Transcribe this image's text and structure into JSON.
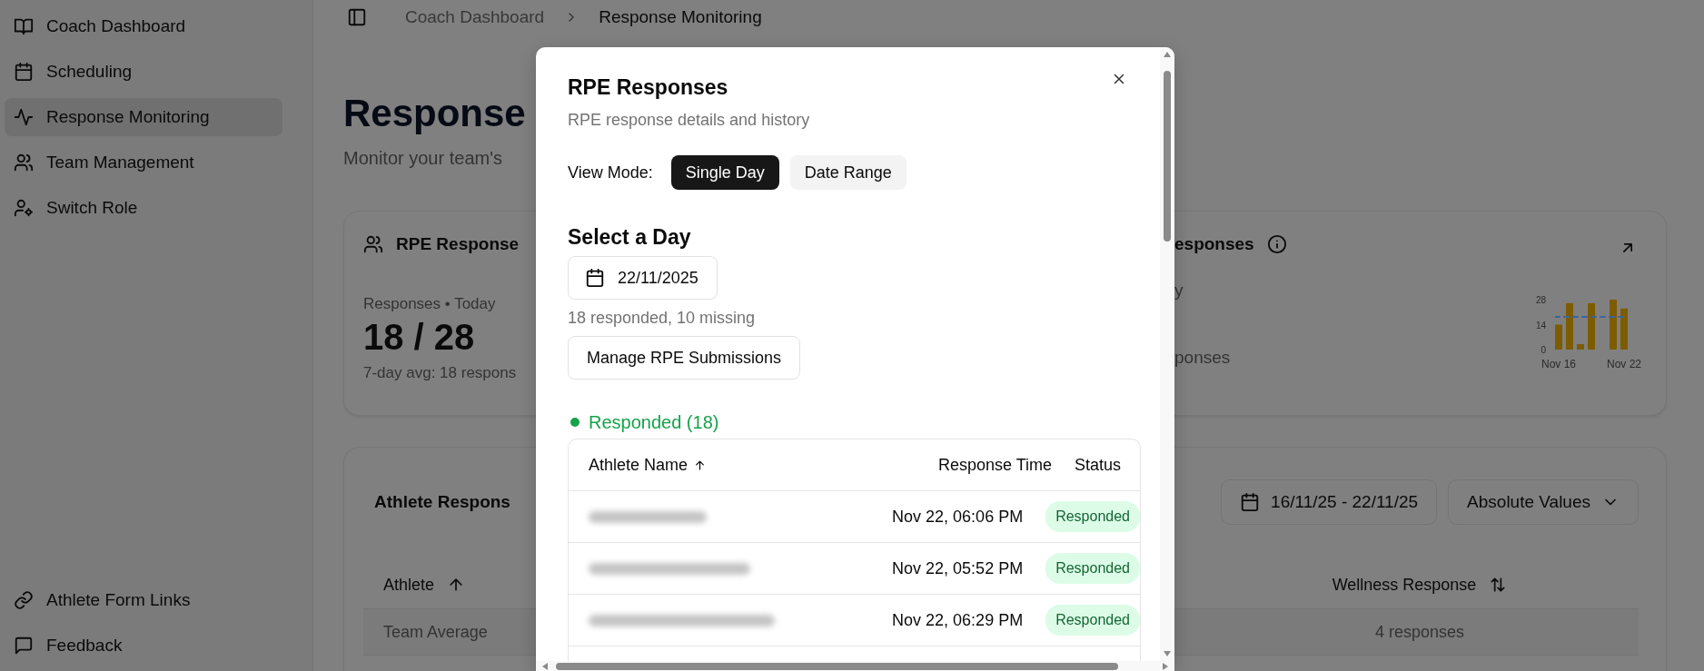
{
  "sidebar": {
    "items": [
      {
        "label": "Coach Dashboard",
        "selected": false
      },
      {
        "label": "Scheduling",
        "selected": false
      },
      {
        "label": "Response Monitoring",
        "selected": true
      },
      {
        "label": "Team Management",
        "selected": false
      },
      {
        "label": "Switch Role",
        "selected": false
      }
    ],
    "footer_items": [
      {
        "label": "Athlete Form Links",
        "selected": false
      },
      {
        "label": "Feedback",
        "selected": false
      }
    ]
  },
  "breadcrumb": [
    "Coach Dashboard",
    "Response Monitoring"
  ],
  "page": {
    "title": "Response",
    "subtitle": "Monitor your team's"
  },
  "summary_card": {
    "title": "RPE Response",
    "label": "Responses • Today",
    "value": "18 / 28",
    "note": "7-day avg: 18 respons",
    "right_title": "esponses",
    "right_label": "y",
    "right_note": "ponses",
    "chart_data": {
      "type": "bar",
      "categories": [
        "Nov 16",
        null,
        null,
        null,
        null,
        null,
        "Nov 22"
      ],
      "yticks": [
        0,
        14,
        28
      ],
      "ylim": [
        0,
        28
      ],
      "series": [
        {
          "color": "#7d5c00",
          "values": [
            14,
            26,
            3,
            26,
            0,
            28,
            23
          ]
        }
      ]
    }
  },
  "responses_card": {
    "title": "Athlete Respons",
    "date_range": "16/11/25 - 22/11/25",
    "mode": "Absolute Values",
    "columns": [
      {
        "label": "Athlete"
      },
      {
        "label": "Wellness Response"
      }
    ],
    "rows": [
      {
        "athlete": "Team Average",
        "wellness": "4 responses"
      }
    ]
  },
  "dialog": {
    "title": "RPE Responses",
    "subtitle": "RPE response details and history",
    "view_mode_label": "View Mode:",
    "modes": [
      {
        "label": "Single Day",
        "selected": true
      },
      {
        "label": "Date Range",
        "selected": false
      }
    ],
    "section_title": "Select a Day",
    "date": "22/11/2025",
    "summary": "18 responded, 10 missing",
    "manage_button": "Manage RPE Submissions",
    "group": {
      "label": "Responded (18)",
      "color": "#16a34a"
    },
    "columns": [
      {
        "label": "Athlete Name"
      },
      {
        "label": "Response Time"
      },
      {
        "label": "Status"
      }
    ],
    "rows": [
      {
        "time": "Nov 22, 06:06 PM",
        "status": "Responded"
      },
      {
        "time": "Nov 22, 05:52 PM",
        "status": "Responded"
      },
      {
        "time": "Nov 22, 06:29 PM",
        "status": "Responded"
      }
    ]
  }
}
